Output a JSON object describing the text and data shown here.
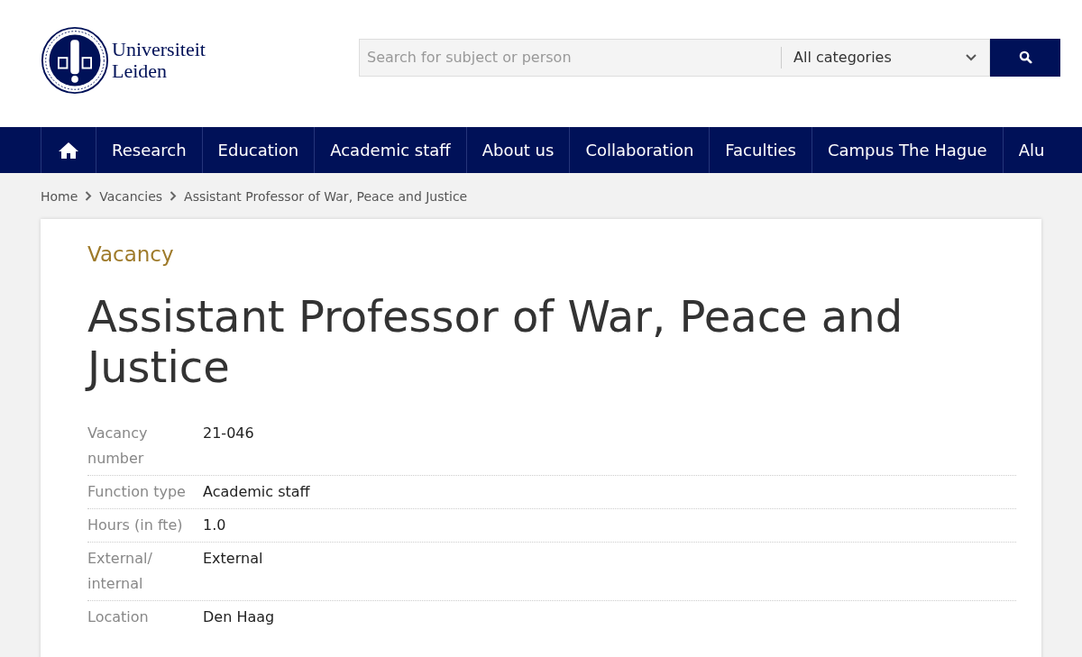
{
  "logo": {
    "lines": [
      "Universiteit",
      "Leiden"
    ]
  },
  "search": {
    "placeholder": "Search for subject or person",
    "category": "All categories"
  },
  "nav": [
    {
      "label": "Research"
    },
    {
      "label": "Education"
    },
    {
      "label": "Academic staff"
    },
    {
      "label": "About us"
    },
    {
      "label": "Collaboration"
    },
    {
      "label": "Faculties"
    },
    {
      "label": "Campus The Hague"
    },
    {
      "label": "Alu"
    }
  ],
  "breadcrumb": [
    "Home",
    "Vacancies",
    "Assistant Professor of War, Peace and Justice"
  ],
  "kicker": "Vacancy",
  "title": "Assistant Professor of War, Peace and Justice",
  "details": [
    {
      "label": "Vacancy number",
      "value": "21-046"
    },
    {
      "label": "Function type",
      "value": "Academic staff"
    },
    {
      "label": "Hours (in fte)",
      "value": "1.0"
    },
    {
      "label": "External/ internal",
      "value": "External"
    },
    {
      "label": "Location",
      "value": "Den Haag"
    }
  ]
}
